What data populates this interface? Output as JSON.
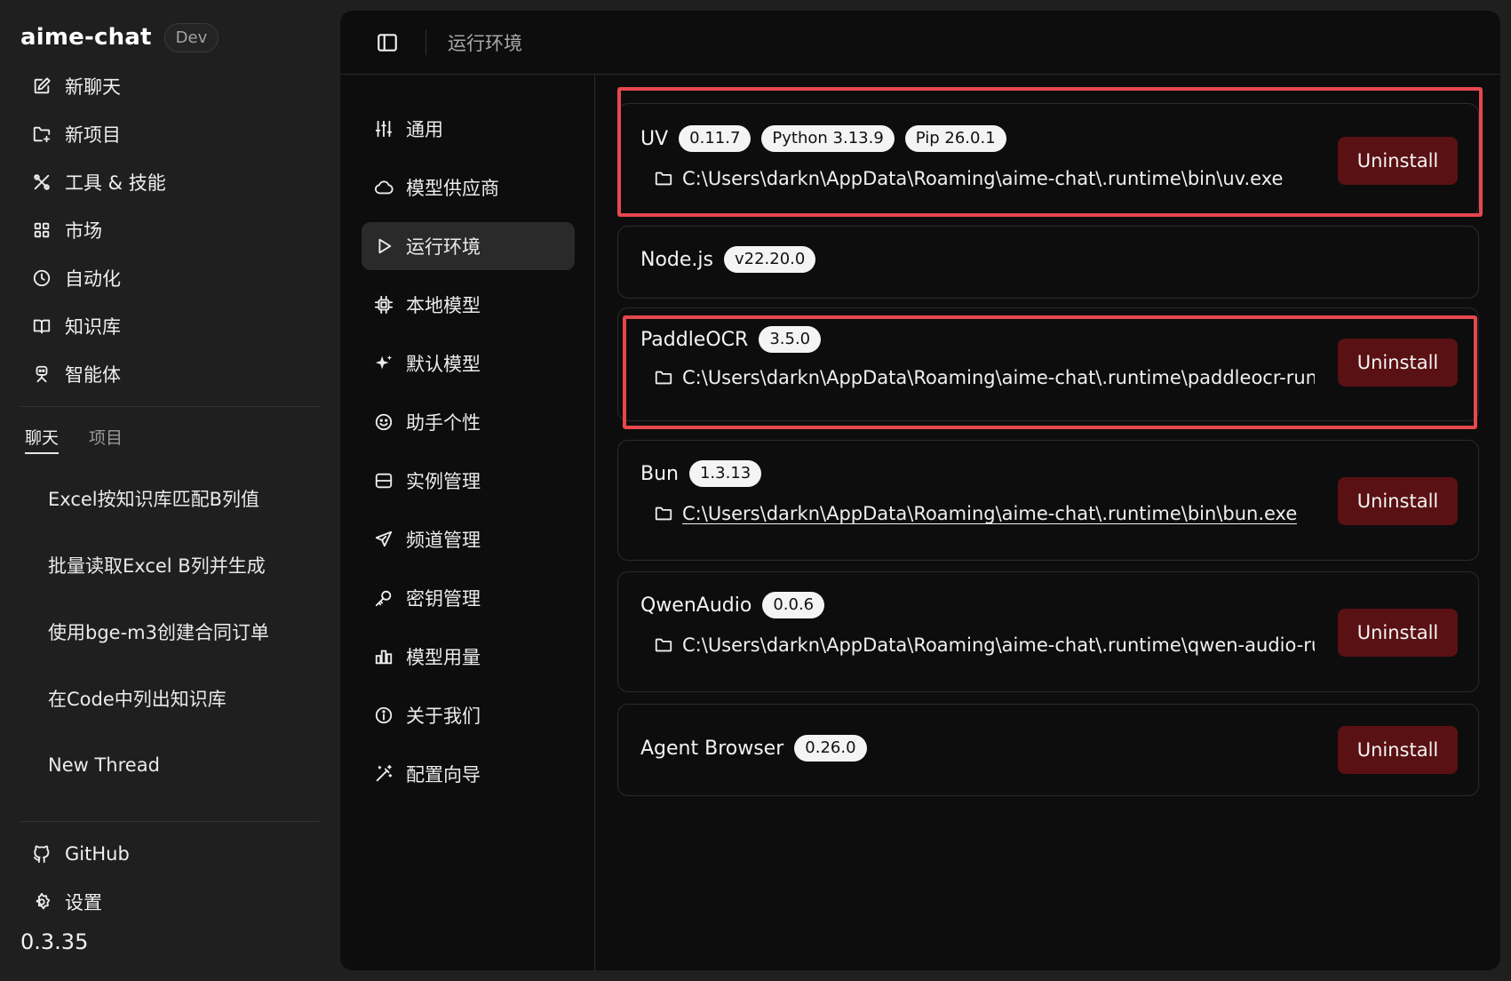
{
  "app": {
    "name": "aime-chat",
    "badge": "Dev",
    "version": "0.3.35"
  },
  "sidebar": {
    "nav": [
      {
        "label": "新聊天",
        "icon": "edit-icon"
      },
      {
        "label": "新项目",
        "icon": "folder-plus-icon"
      },
      {
        "label": "工具 & 技能",
        "icon": "tools-icon"
      },
      {
        "label": "市场",
        "icon": "grid-icon"
      },
      {
        "label": "自动化",
        "icon": "clock-icon"
      },
      {
        "label": "知识库",
        "icon": "book-icon"
      },
      {
        "label": "智能体",
        "icon": "bot-icon"
      }
    ],
    "tabs": {
      "chat": "聊天",
      "project": "项目"
    },
    "threads": [
      "Excel按知识库匹配B列值",
      "批量读取Excel B列并生成",
      "使用bge-m3创建合同订单",
      "在Code中列出知识库",
      "New Thread"
    ],
    "bottom": [
      {
        "label": "GitHub",
        "icon": "github-icon"
      },
      {
        "label": "设置",
        "icon": "gear-icon"
      }
    ]
  },
  "header": {
    "title": "运行环境"
  },
  "settings_nav": [
    {
      "label": "通用",
      "icon": "sliders-icon"
    },
    {
      "label": "模型供应商",
      "icon": "cloud-icon"
    },
    {
      "label": "运行环境",
      "icon": "play-icon"
    },
    {
      "label": "本地模型",
      "icon": "chip-icon"
    },
    {
      "label": "默认模型",
      "icon": "sparkles-icon"
    },
    {
      "label": "助手个性",
      "icon": "smile-icon"
    },
    {
      "label": "实例管理",
      "icon": "server-icon"
    },
    {
      "label": "频道管理",
      "icon": "send-icon"
    },
    {
      "label": "密钥管理",
      "icon": "key-icon"
    },
    {
      "label": "模型用量",
      "icon": "bar-chart-icon"
    },
    {
      "label": "关于我们",
      "icon": "info-icon"
    },
    {
      "label": "配置向导",
      "icon": "wand-icon"
    }
  ],
  "runtimes": [
    {
      "name": "UV",
      "badges": [
        "0.11.7",
        "Python 3.13.9",
        "Pip 26.0.1"
      ],
      "path": "C:\\Users\\darkn\\AppData\\Roaming\\aime-chat\\.runtime\\bin\\uv.exe",
      "action": "Uninstall"
    },
    {
      "name": "Node.js",
      "badges": [
        "v22.20.0"
      ]
    },
    {
      "name": "PaddleOCR",
      "badges": [
        "3.5.0"
      ],
      "path": "C:\\Users\\darkn\\AppData\\Roaming\\aime-chat\\.runtime\\paddleocr-runtime",
      "action": "Uninstall"
    },
    {
      "name": "Bun",
      "badges": [
        "1.3.13"
      ],
      "path": "C:\\Users\\darkn\\AppData\\Roaming\\aime-chat\\.runtime\\bin\\bun.exe",
      "action": "Uninstall"
    },
    {
      "name": "QwenAudio",
      "badges": [
        "0.0.6"
      ],
      "path": "C:\\Users\\darkn\\AppData\\Roaming\\aime-chat\\.runtime\\qwen-audio-runtime",
      "action": "Uninstall"
    },
    {
      "name": "Agent Browser",
      "badges": [
        "0.26.0"
      ],
      "action": "Uninstall"
    }
  ],
  "colors": {
    "accent_danger": "#5a1114",
    "highlight": "#e5484d",
    "panel_bg": "#0d0d0d",
    "sidebar_bg": "#1f1f1f"
  }
}
